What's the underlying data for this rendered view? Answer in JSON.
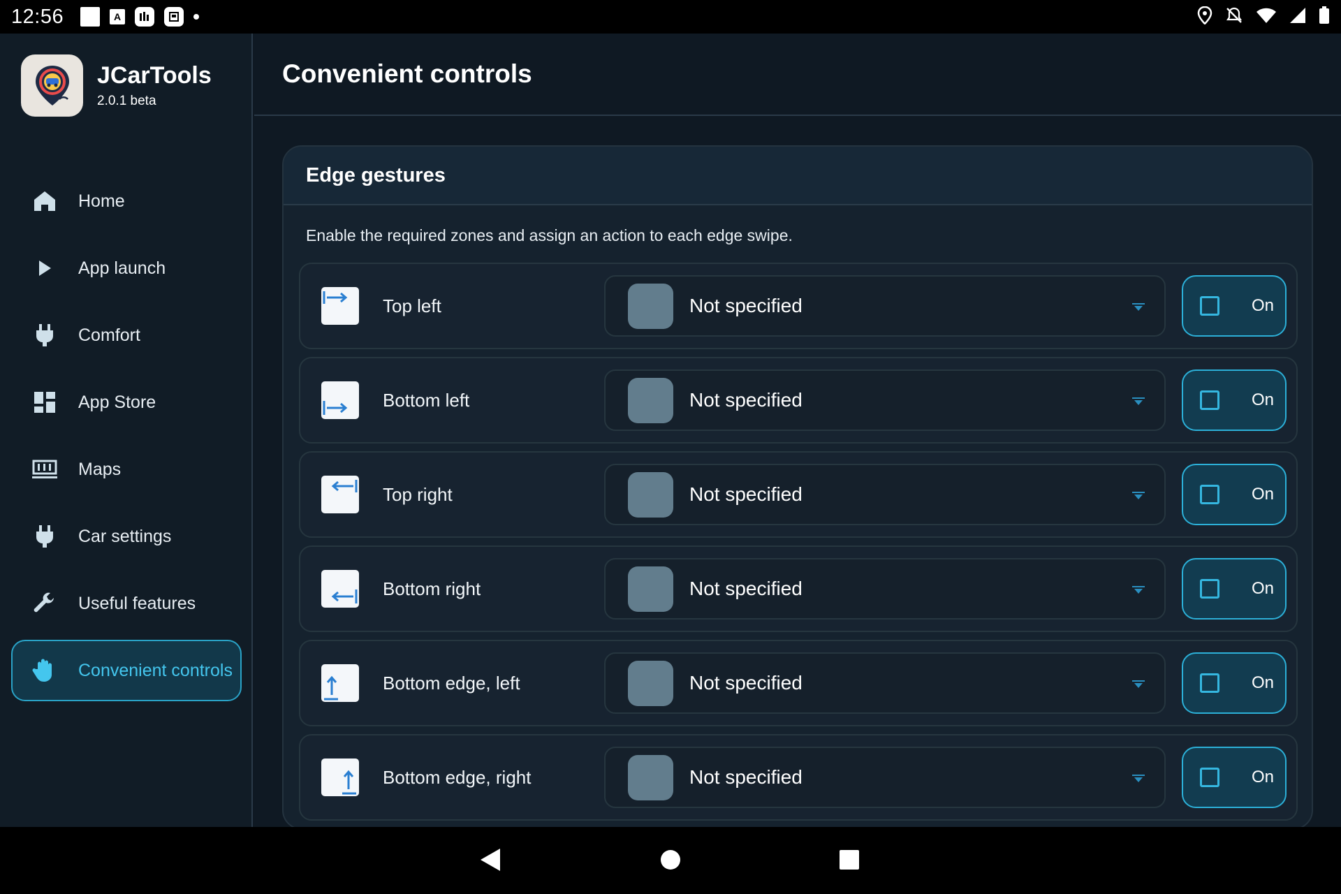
{
  "status_bar": {
    "time": "12:56",
    "notification_icons": [
      "square-icon",
      "a-icon",
      "app-icon",
      "clipboard-icon",
      "dot-icon"
    ],
    "system_icons": [
      "location-icon",
      "notifications-off-icon",
      "wifi-icon",
      "signal-icon",
      "battery-icon"
    ]
  },
  "app": {
    "name": "JCarTools",
    "version": "2.0.1 beta"
  },
  "sidebar": {
    "items": [
      {
        "label": "Home",
        "icon": "home-icon",
        "active": false
      },
      {
        "label": "App launch",
        "icon": "play-icon",
        "active": false
      },
      {
        "label": "Comfort",
        "icon": "plug-icon",
        "active": false
      },
      {
        "label": "App Store",
        "icon": "dashboard-icon",
        "active": false
      },
      {
        "label": "Maps",
        "icon": "map-icon",
        "active": false
      },
      {
        "label": "Car settings",
        "icon": "plug-icon",
        "active": false
      },
      {
        "label": "Useful features",
        "icon": "wrench-icon",
        "active": false
      },
      {
        "label": "Convenient controls",
        "icon": "hand-icon",
        "active": true
      }
    ]
  },
  "main": {
    "title": "Convenient controls",
    "card": {
      "title": "Edge gestures",
      "description": "Enable the required zones and assign an action to each edge swipe.",
      "rows": [
        {
          "label": "Top left",
          "icon": "top-left-swipe-icon",
          "action": "Not specified",
          "toggle_label": "On",
          "checked": false
        },
        {
          "label": "Bottom left",
          "icon": "bottom-left-swipe-icon",
          "action": "Not specified",
          "toggle_label": "On",
          "checked": false
        },
        {
          "label": "Top right",
          "icon": "top-right-swipe-icon",
          "action": "Not specified",
          "toggle_label": "On",
          "checked": false
        },
        {
          "label": "Bottom right",
          "icon": "bottom-right-swipe-icon",
          "action": "Not specified",
          "toggle_label": "On",
          "checked": false
        },
        {
          "label": "Bottom edge, left",
          "icon": "bottom-edge-left-swipe-icon",
          "action": "Not specified",
          "toggle_label": "On",
          "checked": false
        },
        {
          "label": "Bottom edge, right",
          "icon": "bottom-edge-right-swipe-icon",
          "action": "Not specified",
          "toggle_label": "On",
          "checked": false
        }
      ]
    }
  },
  "colors": {
    "accent": "#2aa3c7",
    "accent_text": "#44c6ee",
    "background": "#0f1923",
    "swatch": "#627d8d"
  },
  "nav_bar": {
    "buttons": [
      "back-icon",
      "home-circle-icon",
      "recents-icon"
    ]
  }
}
